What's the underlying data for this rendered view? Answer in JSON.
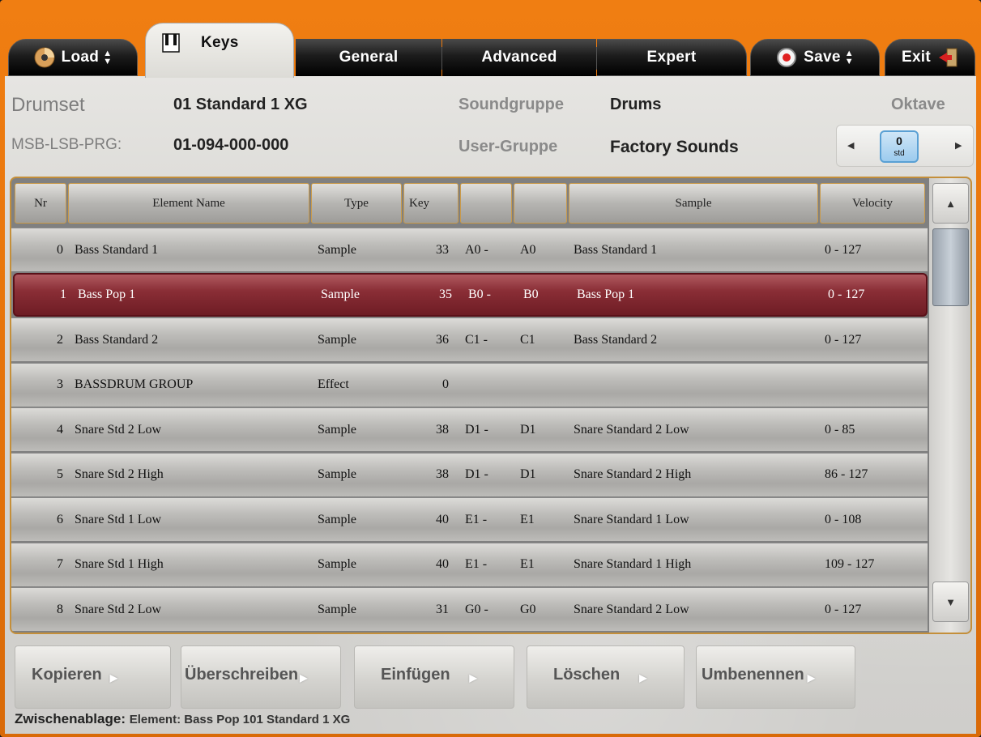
{
  "tabs": {
    "load": "Load",
    "keys": "Keys",
    "general": "General",
    "advanced": "Advanced",
    "expert": "Expert",
    "save": "Save",
    "exit": "Exit"
  },
  "header": {
    "drumset_label": "Drumset",
    "drumset_value": "01 Standard 1 XG",
    "msb_label": "MSB-LSB-PRG:",
    "msb_value": "01-094-000-000",
    "soundgruppe_label": "Soundgruppe",
    "soundgruppe_value": "Drums",
    "usergruppe_label": "User-Gruppe",
    "usergruppe_value": "Factory Sounds",
    "oktave_label": "Oktave",
    "oktave_value": "0",
    "oktave_sub": "std"
  },
  "table": {
    "columns": {
      "nr": "Nr",
      "name": "Element Name",
      "type": "Type",
      "key": "Key",
      "from": "",
      "to": "",
      "sample": "Sample",
      "velocity": "Velocity"
    },
    "rows": [
      {
        "nr": "0",
        "name": "Bass Standard 1",
        "type": "Sample",
        "key": "33",
        "from": "A0 -",
        "to": "A0",
        "sample": "Bass Standard 1",
        "velocity": "0 - 127"
      },
      {
        "nr": "1",
        "name": "Bass Pop 1",
        "type": "Sample",
        "key": "35",
        "from": "B0 -",
        "to": "B0",
        "sample": "Bass Pop 1",
        "velocity": "0 - 127"
      },
      {
        "nr": "2",
        "name": "Bass Standard 2",
        "type": "Sample",
        "key": "36",
        "from": "C1 -",
        "to": "C1",
        "sample": "Bass Standard 2",
        "velocity": "0 - 127"
      },
      {
        "nr": "3",
        "name": "BASSDRUM GROUP",
        "type": "Effect",
        "key": "0",
        "from": "",
        "to": "",
        "sample": "",
        "velocity": ""
      },
      {
        "nr": "4",
        "name": "Snare Std 2 Low",
        "type": "Sample",
        "key": "38",
        "from": "D1 -",
        "to": "D1",
        "sample": "Snare Standard 2 Low",
        "velocity": "0 - 85"
      },
      {
        "nr": "5",
        "name": "Snare Std 2 High",
        "type": "Sample",
        "key": "38",
        "from": "D1 -",
        "to": "D1",
        "sample": "Snare Standard 2 High",
        "velocity": "86 - 127"
      },
      {
        "nr": "6",
        "name": "Snare Std 1 Low",
        "type": "Sample",
        "key": "40",
        "from": "E1 -",
        "to": "E1",
        "sample": "Snare Standard 1 Low",
        "velocity": "0 - 108"
      },
      {
        "nr": "7",
        "name": "Snare Std 1 High",
        "type": "Sample",
        "key": "40",
        "from": "E1 -",
        "to": "E1",
        "sample": "Snare Standard 1 High",
        "velocity": "109 - 127"
      },
      {
        "nr": "8",
        "name": "Snare Std 2 Low",
        "type": "Sample",
        "key": "31",
        "from": "G0 -",
        "to": "G0",
        "sample": "Snare Standard 2 Low",
        "velocity": "0 - 127"
      }
    ],
    "selected_index": 1
  },
  "buttons": {
    "kopieren": "Kopieren",
    "ueberschreiben": "Überschreiben",
    "einfuegen": "Einfügen",
    "loeschen": "Löschen",
    "umbenennen": "Umbenennen"
  },
  "clipboard": {
    "label": "Zwischenablage:",
    "value": "Element: Bass Pop 101 Standard 1 XG"
  },
  "colors": {
    "frame_orange": "#e8760c",
    "selected_row": "#8a2e36",
    "table_border": "#c48f3a",
    "oktave_value_bg": "#9ccbee"
  }
}
